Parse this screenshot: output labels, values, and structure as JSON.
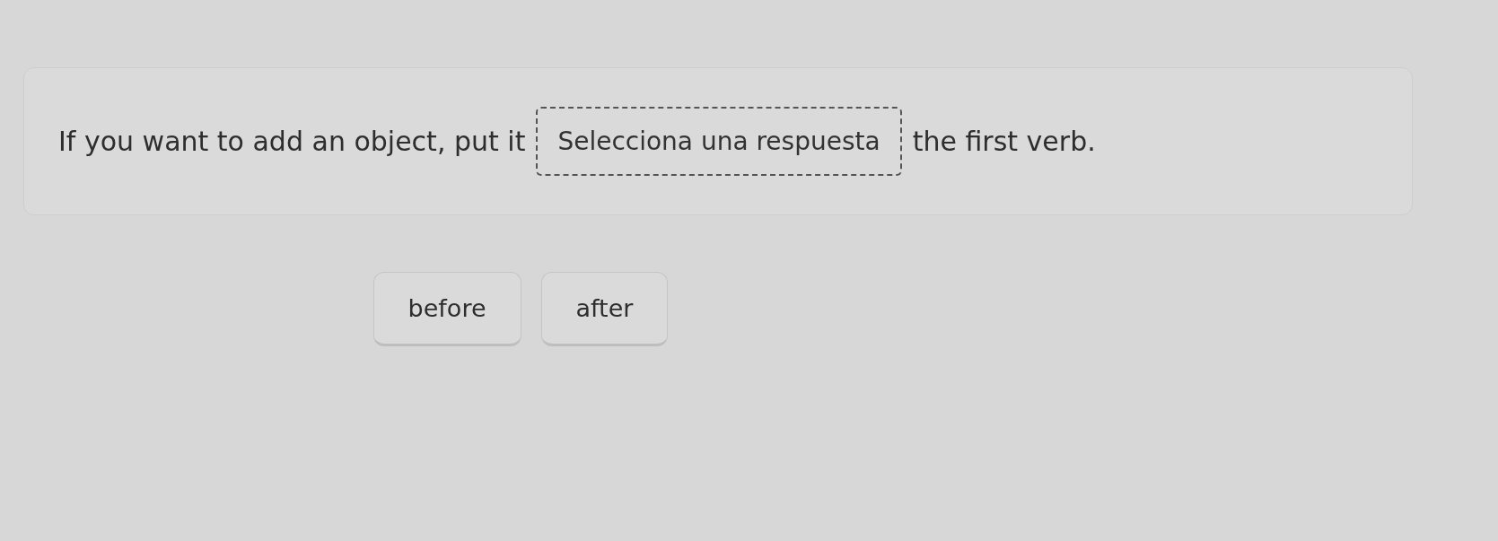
{
  "prompt": {
    "before_text": "If you want to add an object, put it",
    "blank": {
      "placeholder": "Selecciona una respuesta"
    },
    "after_text": "the first verb."
  },
  "options": [
    {
      "label": "before"
    },
    {
      "label": "after"
    }
  ]
}
